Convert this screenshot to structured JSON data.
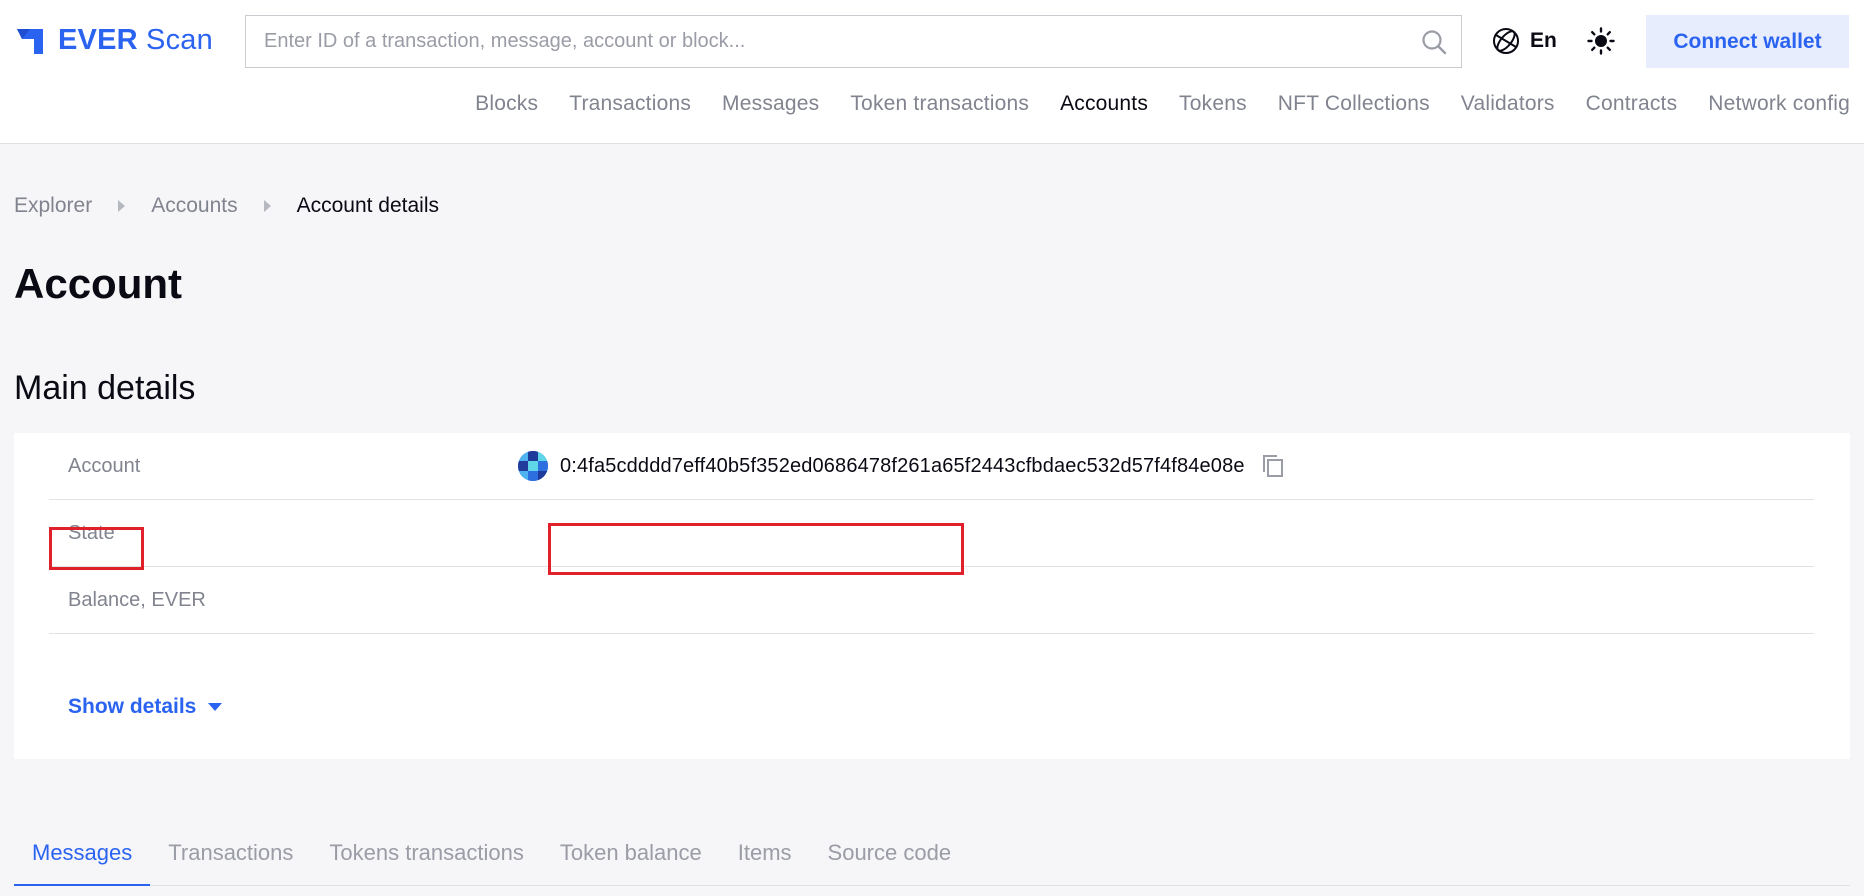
{
  "colors": {
    "accent": "#2b63f1",
    "highlight": "#e0202b",
    "muted": "#81848f"
  },
  "header": {
    "logo_bold": "EVER",
    "logo_light": "Scan",
    "search_placeholder": "Enter ID of a transaction, message, account or block...",
    "language": "En",
    "connect_label": "Connect wallet"
  },
  "nav": [
    "Blocks",
    "Transactions",
    "Messages",
    "Token transactions",
    "Accounts",
    "Tokens",
    "NFT Collections",
    "Validators",
    "Contracts",
    "Network config"
  ],
  "nav_active": "Accounts",
  "breadcrumb": [
    "Explorer",
    "Accounts",
    "Account details"
  ],
  "page_title": "Account",
  "main_details": {
    "title": "Main details",
    "account_label": "Account",
    "account_value": "0:4fa5cdddd7eff40b5f352ed0686478f261a65f2443cfbdaec532d57f4f84e08e",
    "state_label": "State",
    "state_value": "",
    "balance_label": "Balance, EVER",
    "balance_value": "",
    "show_details": "Show details"
  },
  "tabs": [
    "Messages",
    "Transactions",
    "Tokens transactions",
    "Token balance",
    "Items",
    "Source code"
  ],
  "tab_active": "Messages"
}
